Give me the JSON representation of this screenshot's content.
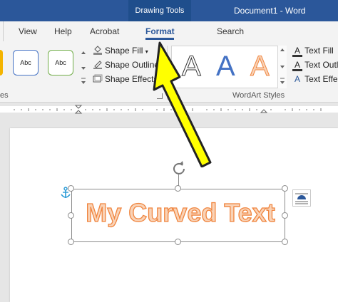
{
  "title_bar": {
    "context_tab": "Drawing Tools",
    "document_title": "Document1 - Word"
  },
  "tabs": [
    "View",
    "Help",
    "Acrobat",
    "Format"
  ],
  "active_tab": "Format",
  "search": {
    "label": "Search"
  },
  "shape_styles": {
    "samples": [
      "Abc",
      "Abc"
    ],
    "commands": {
      "fill": "Shape Fill",
      "outline": "Shape Outline",
      "effects": "Shape Effects"
    },
    "group_label_partial": "es"
  },
  "wordart_styles": {
    "letters": [
      "A",
      "A",
      "A"
    ],
    "group_label": "WordArt Styles",
    "commands": {
      "fill": "Text Fill",
      "outline": "Text Outli",
      "effects": "Text Effec"
    }
  },
  "document": {
    "wordart_text": "My Curved Text"
  },
  "colors": {
    "accent": "#2b579a",
    "wordart_fill": "#f9d3b7",
    "wordart_stroke": "#f0853f",
    "arrow": "#ffff00"
  }
}
